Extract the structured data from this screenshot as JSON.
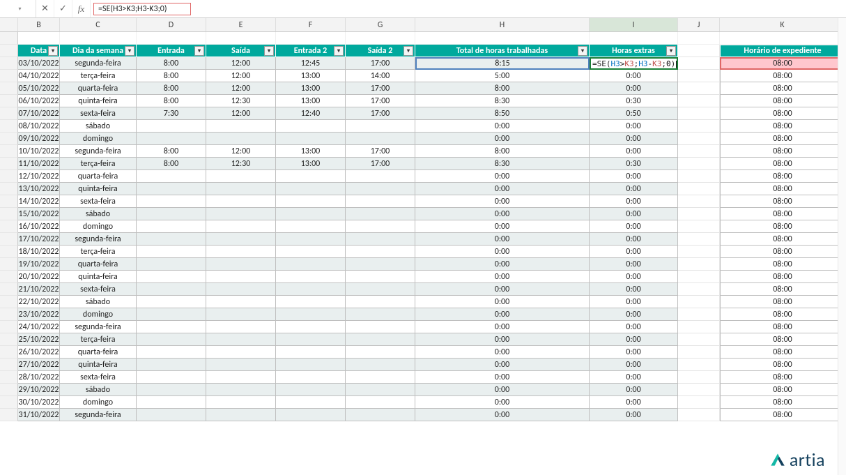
{
  "formula_bar": {
    "namebox": "",
    "cancel_icon": "✕",
    "confirm_icon": "✓",
    "fx_label": "fx",
    "formula_text": "=SE(H3>K3;H3-K3;0)"
  },
  "columns": [
    "",
    "B",
    "C",
    "D",
    "E",
    "F",
    "G",
    "H",
    "I",
    "J",
    "K",
    ""
  ],
  "active_column_index": 8,
  "table_headers": {
    "B": "Data",
    "C": "Dia da semana",
    "D": "Entrada",
    "E": "Saída",
    "F": "Entrada 2",
    "G": "Saída 2",
    "H": "Total de horas trabalhadas",
    "I": "Horas extras",
    "K": "Horário de expediente"
  },
  "dropdown_glyph": "▾",
  "rows": [
    {
      "n": 3,
      "B": "03/10/2022",
      "C": "segunda-feira",
      "D": "8:00",
      "E": "12:00",
      "F": "12:45",
      "G": "17:00",
      "H": "8:15",
      "I": "=SE(H3>K3;H3-K3;0)",
      "K": "08:00",
      "edit": true,
      "hlH": true,
      "hlK": true
    },
    {
      "n": 4,
      "B": "04/10/2022",
      "C": "terça-feira",
      "D": "8:00",
      "E": "12:00",
      "F": "13:00",
      "G": "14:00",
      "H": "5:00",
      "I": "0:00",
      "K": "08:00"
    },
    {
      "n": 5,
      "B": "05/10/2022",
      "C": "quarta-feira",
      "D": "8:00",
      "E": "12:00",
      "F": "13:00",
      "G": "17:00",
      "H": "8:00",
      "I": "0:00",
      "K": "08:00"
    },
    {
      "n": 6,
      "B": "06/10/2022",
      "C": "quinta-feira",
      "D": "8:00",
      "E": "12:30",
      "F": "13:00",
      "G": "17:00",
      "H": "8:30",
      "I": "0:30",
      "K": "08:00"
    },
    {
      "n": 7,
      "B": "07/10/2022",
      "C": "sexta-feira",
      "D": "7:30",
      "E": "12:00",
      "F": "12:40",
      "G": "17:00",
      "H": "8:50",
      "I": "0:50",
      "K": "08:00"
    },
    {
      "n": 8,
      "B": "08/10/2022",
      "C": "sábado",
      "D": "",
      "E": "",
      "F": "",
      "G": "",
      "H": "0:00",
      "I": "0:00",
      "K": "08:00"
    },
    {
      "n": 9,
      "B": "09/10/2022",
      "C": "domingo",
      "D": "",
      "E": "",
      "F": "",
      "G": "",
      "H": "0:00",
      "I": "0:00",
      "K": "08:00"
    },
    {
      "n": 10,
      "B": "10/10/2022",
      "C": "segunda-feira",
      "D": "8:00",
      "E": "12:00",
      "F": "13:00",
      "G": "17:00",
      "H": "8:00",
      "I": "0:00",
      "K": "08:00"
    },
    {
      "n": 11,
      "B": "11/10/2022",
      "C": "terça-feira",
      "D": "8:00",
      "E": "12:30",
      "F": "13:00",
      "G": "17:00",
      "H": "8:30",
      "I": "0:30",
      "K": "08:00"
    },
    {
      "n": 12,
      "B": "12/10/2022",
      "C": "quarta-feira",
      "D": "",
      "E": "",
      "F": "",
      "G": "",
      "H": "0:00",
      "I": "0:00",
      "K": "08:00"
    },
    {
      "n": 13,
      "B": "13/10/2022",
      "C": "quinta-feira",
      "D": "",
      "E": "",
      "F": "",
      "G": "",
      "H": "0:00",
      "I": "0:00",
      "K": "08:00"
    },
    {
      "n": 14,
      "B": "14/10/2022",
      "C": "sexta-feira",
      "D": "",
      "E": "",
      "F": "",
      "G": "",
      "H": "0:00",
      "I": "0:00",
      "K": "08:00"
    },
    {
      "n": 15,
      "B": "15/10/2022",
      "C": "sábado",
      "D": "",
      "E": "",
      "F": "",
      "G": "",
      "H": "0:00",
      "I": "0:00",
      "K": "08:00"
    },
    {
      "n": 16,
      "B": "16/10/2022",
      "C": "domingo",
      "D": "",
      "E": "",
      "F": "",
      "G": "",
      "H": "0:00",
      "I": "0:00",
      "K": "08:00"
    },
    {
      "n": 17,
      "B": "17/10/2022",
      "C": "segunda-feira",
      "D": "",
      "E": "",
      "F": "",
      "G": "",
      "H": "0:00",
      "I": "0:00",
      "K": "08:00"
    },
    {
      "n": 18,
      "B": "18/10/2022",
      "C": "terça-feira",
      "D": "",
      "E": "",
      "F": "",
      "G": "",
      "H": "0:00",
      "I": "0:00",
      "K": "08:00"
    },
    {
      "n": 19,
      "B": "19/10/2022",
      "C": "quarta-feira",
      "D": "",
      "E": "",
      "F": "",
      "G": "",
      "H": "0:00",
      "I": "0:00",
      "K": "08:00"
    },
    {
      "n": 20,
      "B": "20/10/2022",
      "C": "quinta-feira",
      "D": "",
      "E": "",
      "F": "",
      "G": "",
      "H": "0:00",
      "I": "0:00",
      "K": "08:00"
    },
    {
      "n": 21,
      "B": "21/10/2022",
      "C": "sexta-feira",
      "D": "",
      "E": "",
      "F": "",
      "G": "",
      "H": "0:00",
      "I": "0:00",
      "K": "08:00"
    },
    {
      "n": 22,
      "B": "22/10/2022",
      "C": "sábado",
      "D": "",
      "E": "",
      "F": "",
      "G": "",
      "H": "0:00",
      "I": "0:00",
      "K": "08:00"
    },
    {
      "n": 23,
      "B": "23/10/2022",
      "C": "domingo",
      "D": "",
      "E": "",
      "F": "",
      "G": "",
      "H": "0:00",
      "I": "0:00",
      "K": "08:00"
    },
    {
      "n": 24,
      "B": "24/10/2022",
      "C": "segunda-feira",
      "D": "",
      "E": "",
      "F": "",
      "G": "",
      "H": "0:00",
      "I": "0:00",
      "K": "08:00"
    },
    {
      "n": 25,
      "B": "25/10/2022",
      "C": "terça-feira",
      "D": "",
      "E": "",
      "F": "",
      "G": "",
      "H": "0:00",
      "I": "0:00",
      "K": "08:00"
    },
    {
      "n": 26,
      "B": "26/10/2022",
      "C": "quarta-feira",
      "D": "",
      "E": "",
      "F": "",
      "G": "",
      "H": "0:00",
      "I": "0:00",
      "K": "08:00"
    },
    {
      "n": 27,
      "B": "27/10/2022",
      "C": "quinta-feira",
      "D": "",
      "E": "",
      "F": "",
      "G": "",
      "H": "0:00",
      "I": "0:00",
      "K": "08:00"
    },
    {
      "n": 28,
      "B": "28/10/2022",
      "C": "sexta-feira",
      "D": "",
      "E": "",
      "F": "",
      "G": "",
      "H": "0:00",
      "I": "0:00",
      "K": "08:00"
    },
    {
      "n": 29,
      "B": "29/10/2022",
      "C": "sábado",
      "D": "",
      "E": "",
      "F": "",
      "G": "",
      "H": "0:00",
      "I": "0:00",
      "K": "08:00"
    },
    {
      "n": 30,
      "B": "30/10/2022",
      "C": "domingo",
      "D": "",
      "E": "",
      "F": "",
      "G": "",
      "H": "0:00",
      "I": "0:00",
      "K": "08:00"
    },
    {
      "n": 31,
      "B": "31/10/2022",
      "C": "segunda-feira",
      "D": "",
      "E": "",
      "F": "",
      "G": "",
      "H": "0:00",
      "I": "0:00",
      "K": "08:00"
    }
  ],
  "edit_tokens": [
    "=SE(",
    "H3",
    ">",
    "K3",
    ";",
    "H3",
    "-",
    "K3",
    ";",
    "0",
    ")"
  ],
  "logo_text": "artia"
}
